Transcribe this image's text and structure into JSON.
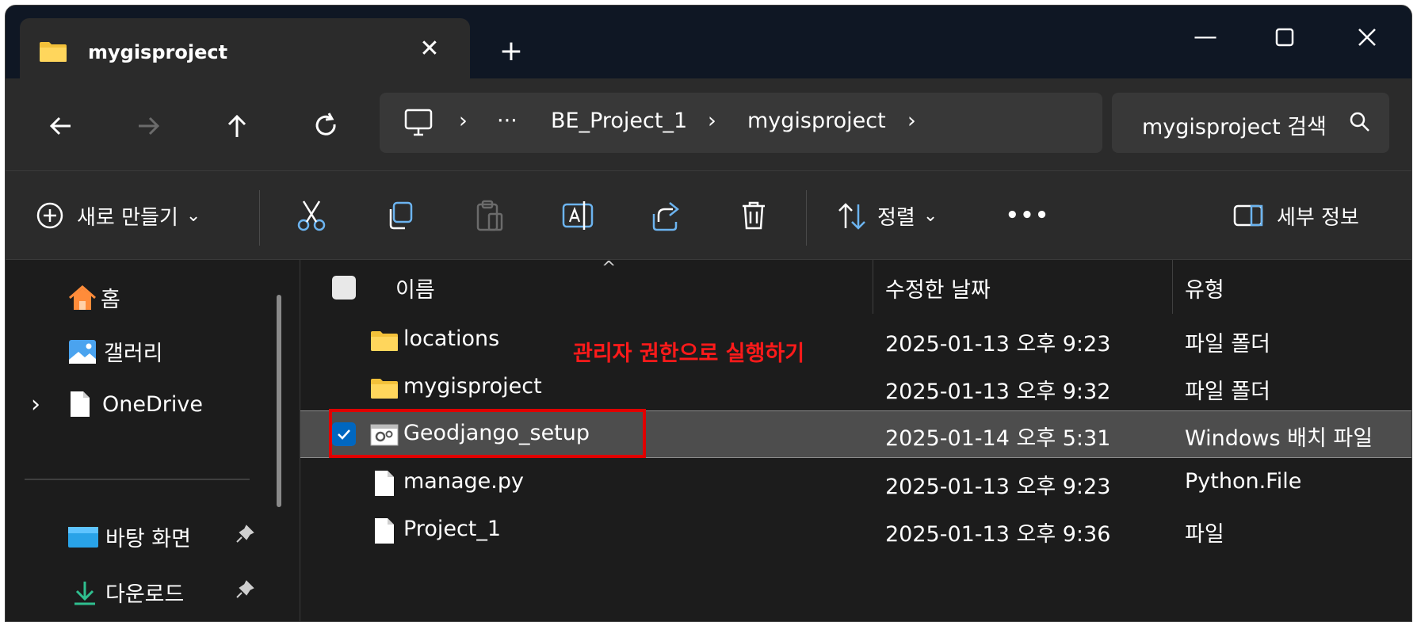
{
  "window": {
    "tab_title": "mygisproject",
    "tab_close": "✕",
    "new_tab": "+",
    "minimize": "—",
    "maximize": "☐",
    "close": "✕"
  },
  "nav": {
    "back": "←",
    "forward": "→",
    "up": "↑",
    "refresh": "↻"
  },
  "address": {
    "overflow": "···",
    "segments": [
      "BE_Project_1",
      "mygisproject"
    ],
    "separator": "›"
  },
  "search": {
    "text": "mygisproject 검색"
  },
  "commands": {
    "new_label": "새로 만들기",
    "sort_label": "정렬",
    "more": "•••",
    "details_label": "세부 정보",
    "dropdown": "⌄"
  },
  "sidebar": {
    "items": [
      {
        "label": "홈",
        "icon": "home-icon"
      },
      {
        "label": "갤러리",
        "icon": "gallery-icon"
      },
      {
        "label": "OneDrive",
        "icon": "file-icon",
        "expand": "›"
      },
      {
        "label": "바탕 화면",
        "icon": "desktop-icon",
        "pinned": true
      },
      {
        "label": "다운로드",
        "icon": "download-icon",
        "pinned": true
      }
    ]
  },
  "columns": {
    "name": "이름",
    "date": "수정한 날짜",
    "type": "유형",
    "sort_indicator": "^"
  },
  "files": [
    {
      "name": "locations",
      "date": "2025-01-13 오후 9:23",
      "type": "파일 폴더",
      "icon": "folder-icon"
    },
    {
      "name": "mygisproject",
      "date": "2025-01-13 오후 9:32",
      "type": "파일 폴더",
      "icon": "folder-icon"
    },
    {
      "name": "Geodjango_setup",
      "date": "2025-01-14 오후 5:31",
      "type": "Windows 배치 파일",
      "icon": "batch-file-icon",
      "selected": true
    },
    {
      "name": "manage.py",
      "date": "2025-01-13 오후 9:23",
      "type": "Python.File",
      "icon": "file-icon"
    },
    {
      "name": "Project_1",
      "date": "2025-01-13 오후 9:36",
      "type": "파일",
      "icon": "file-icon"
    }
  ],
  "annotation": {
    "text": "관리자 권한으로 실행하기",
    "color": "#ff1a1a"
  },
  "colors": {
    "accent": "#0067c0",
    "background": "#1c1c1c",
    "folder": "#f3c13a"
  }
}
